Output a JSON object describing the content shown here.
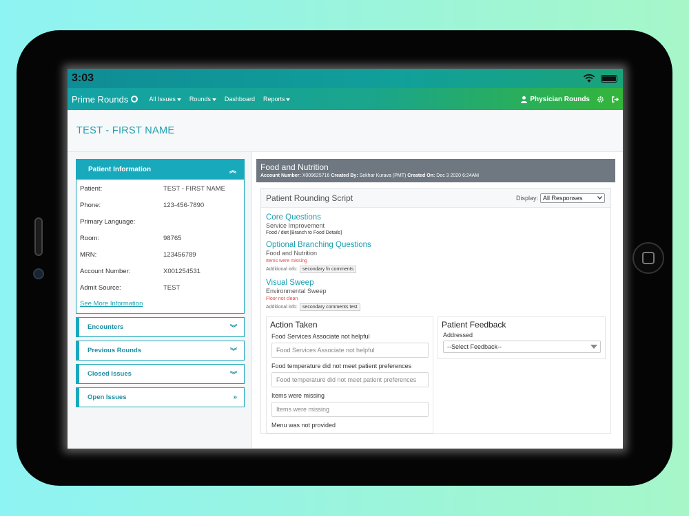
{
  "status_bar": {
    "time": "3:03"
  },
  "navbar": {
    "brand": "Prime Rounds",
    "links": [
      "All Issues",
      "Rounds",
      "Dashboard",
      "Reports"
    ],
    "user": "Physician Rounds"
  },
  "page": {
    "title": "TEST - FIRST NAME"
  },
  "patient_panel": {
    "header": "Patient Information",
    "rows": [
      {
        "label": "Patient:",
        "value": "TEST - FIRST NAME"
      },
      {
        "label": "Phone:",
        "value": "123-456-7890"
      },
      {
        "label": "Primary Language:",
        "value": ""
      },
      {
        "label": "Room:",
        "value": "98765"
      },
      {
        "label": "MRN:",
        "value": "123456789"
      },
      {
        "label": "Account Number:",
        "value": "X001254531"
      },
      {
        "label": "Admit Source:",
        "value": "TEST"
      }
    ],
    "see_more": "See More Information"
  },
  "collapsed_panels": [
    "Encounters",
    "Previous Rounds",
    "Closed Issues",
    "Open Issues"
  ],
  "round": {
    "title": "Food and Nutrition",
    "account_label": "Account Number:",
    "account": "X009625716",
    "created_by_label": "Created By:",
    "created_by": "Sekhar Kurava (PMT)",
    "created_on_label": "Created On:",
    "created_on": "Dec 3 2020 6:24AM"
  },
  "script": {
    "title": "Patient Rounding Script",
    "display_label": "Display:",
    "display_value": "All Responses",
    "sections": [
      {
        "title": "Core Questions",
        "subtitle": "Service Improvement",
        "detail": "Food / diet [Branch to Food Details]"
      },
      {
        "title": "Optional Branching Questions",
        "subtitle": "Food and Nutrition",
        "issue": "Items were missing",
        "info_label": "Additional info:",
        "info": "secondary fn comments"
      },
      {
        "title": "Visual Sweep",
        "subtitle": "Environmental Sweep",
        "issue": "Floor not clean",
        "info_label": "Additional info:",
        "info": "secondary comments test"
      }
    ]
  },
  "action_taken": {
    "title": "Action Taken",
    "fields": [
      {
        "label": "Food Services Associate not helpful",
        "placeholder": "Food Services Associate not helpful"
      },
      {
        "label": "Food temperature did not meet patient preferences",
        "placeholder": "Food temperature did not meet patient preferences"
      },
      {
        "label": "Items were missing",
        "placeholder": "Items were missing"
      },
      {
        "label": "Menu was not provided",
        "placeholder": ""
      }
    ]
  },
  "patient_feedback": {
    "title": "Patient Feedback",
    "label": "Addressed",
    "select": "--Select Feedback--"
  },
  "colors": {
    "accent": "#19a9bd",
    "nav_start": "#13a2a6",
    "nav_end": "#34b53a",
    "error": "#e0474c",
    "header_gray": "#6f7780"
  }
}
